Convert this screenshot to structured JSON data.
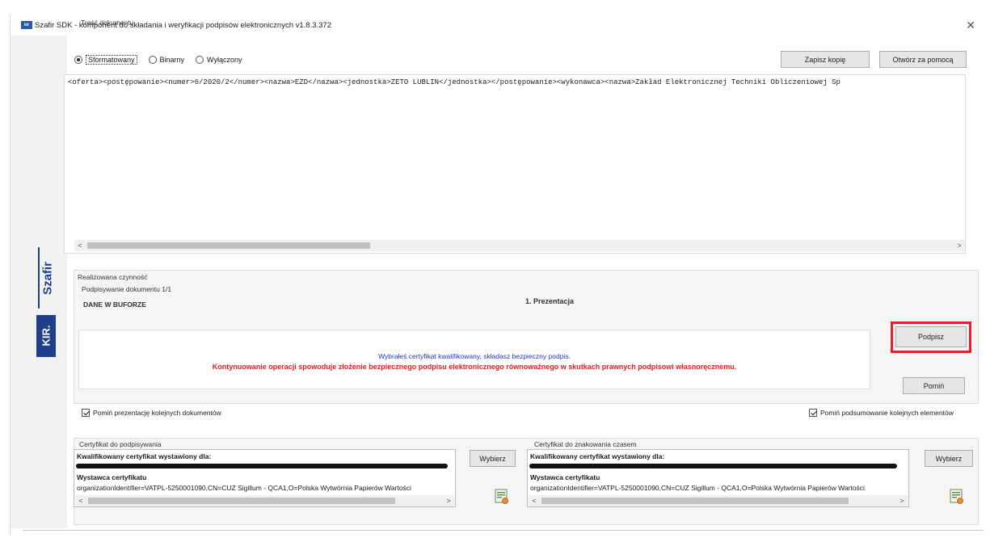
{
  "window": {
    "title": "Szafir SDK - komponent do składania i weryfikacji podpisów elektronicznych v1.8.3.372",
    "app_icon_text": "kir",
    "close_icon": "close-icon"
  },
  "branding": {
    "szafir": "Szafir",
    "kir": "KIR."
  },
  "document": {
    "group_title": "Treść dokumentu",
    "modes": [
      {
        "label": "Sformatowany",
        "selected": true
      },
      {
        "label": "Binarny",
        "selected": false
      },
      {
        "label": "Wyłączony",
        "selected": false
      }
    ],
    "save_copy_label": "Zapisz kopię",
    "open_with_label": "Otwórz za pomocą",
    "content": "<oferta><postępowanie><numer>6/2020/2</numer><nazwa>EZD</nazwa><jednostka>ZETO LUBLIN</jednostka></postępowanie><wykonawca><nazwa>Zakład Elektronicznej Techniki Obliczeniowej Sp"
  },
  "activity": {
    "group_title": "Realizowana czynność",
    "subtitle": "Podpisywanie dokumentu 1/1",
    "buffer_label": "DANE W BUFORZE",
    "step_label": "1. Prezentacja",
    "info_blue": "Wybrałeś certyfikat kwalifikowany, składasz bezpieczny podpis.",
    "info_red": "Kontynuowanie operacji spowoduje złożenie bezpiecznego podpisu elektronicznego równoważnego w skutkach prawnych podpisowi własnoręcznemu.",
    "sign_label": "Podpisz",
    "skip_label": "Pomiń"
  },
  "options": {
    "skip_presentation": {
      "label": "Pomiń prezentację kolejnych dokumentów",
      "checked": true
    },
    "skip_summary": {
      "label": "Pomiń podsumowanie kolejnych elementów",
      "checked": true
    }
  },
  "certificates": {
    "signing": {
      "group_title": "Certyfikat do podpisywania",
      "issued_for_label": "Kwalifikowany certyfikat wystawiony dla:",
      "issuer_label": "Wystawca certyfikatu",
      "issuer_value": "organizationIdentifier=VATPL-5250001090,CN=CUZ Sigillum - QCA1,O=Polska Wytwórnia Papierów Wartości",
      "choose_label": "Wybierz"
    },
    "timestamp": {
      "group_title": "Certyfikat do znakowania czasem",
      "issued_for_label": "Kwalifikowany certyfikat wystawiony dla:",
      "issuer_label": "Wystawca certyfikatu",
      "issuer_value": "organizationIdentifier=VATPL-5250001090,CN=CUZ Sigillum - QCA1,O=Polska Wytwórnia Papierów Wartości",
      "choose_label": "Wybierz"
    }
  },
  "colors": {
    "brand_blue": "#1f3f8c",
    "warning_red": "#e02020",
    "info_blue": "#2233dd",
    "highlight_red": "#e0202a"
  }
}
